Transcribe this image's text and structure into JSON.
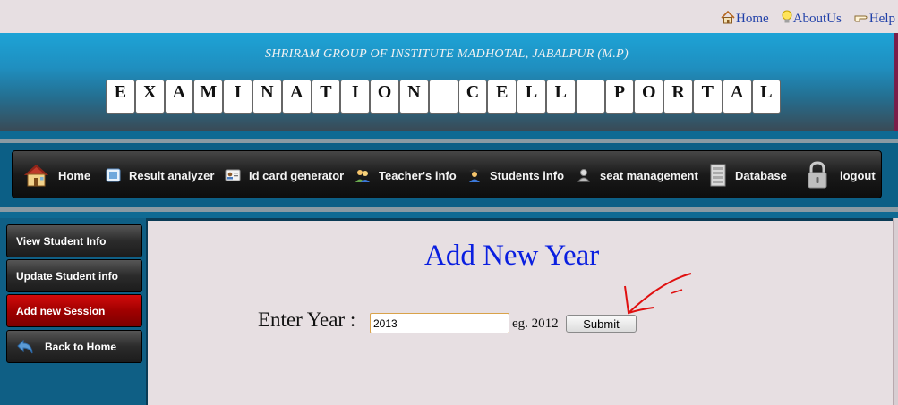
{
  "toplinks": {
    "home": "Home",
    "about": "AboutUs",
    "help": "Help"
  },
  "header": {
    "institute": "SHRIRAM GROUP OF INSTITUTE MADHOTAL, JABALPUR (M.P)",
    "title_letters": [
      "E",
      "X",
      "A",
      "M",
      "I",
      "N",
      "A",
      "T",
      "I",
      "O",
      "N",
      " ",
      "C",
      "E",
      "L",
      "L",
      " ",
      "P",
      "O",
      "R",
      "T",
      "A",
      "L"
    ]
  },
  "nav": {
    "items": [
      {
        "label": "Home",
        "icon": "house-icon"
      },
      {
        "label": "Result analyzer",
        "icon": "result-icon"
      },
      {
        "label": "Id card generator",
        "icon": "id-card-icon"
      },
      {
        "label": "Teacher's info",
        "icon": "teachers-icon"
      },
      {
        "label": "Students info",
        "icon": "student-icon"
      },
      {
        "label": "seat management",
        "icon": "seat-icon"
      },
      {
        "label": "Database",
        "icon": "database-icon"
      },
      {
        "label": "logout",
        "icon": "padlock-icon"
      }
    ]
  },
  "sidebar": {
    "items": [
      {
        "label": "View Student Info",
        "active": false
      },
      {
        "label": "Update Student info",
        "active": false
      },
      {
        "label": "Add new Session",
        "active": true
      },
      {
        "label": "Back to Home",
        "active": false,
        "icon": "back-arrow-icon"
      }
    ]
  },
  "main": {
    "title": "Add New Year",
    "year_label": "Enter Year :",
    "year_value": "2013",
    "example": "eg. 2012",
    "submit_label": "Submit"
  },
  "colors": {
    "title": "#0a1fe0",
    "active_sidebar": "#a00000",
    "annotation_arrow": "#e01010"
  }
}
